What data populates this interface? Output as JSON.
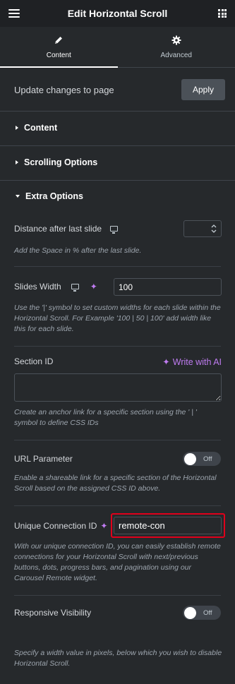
{
  "header": {
    "title": "Edit Horizontal Scroll"
  },
  "tabs": [
    {
      "label": "Content"
    },
    {
      "label": "Advanced"
    }
  ],
  "update": {
    "text": "Update changes to page",
    "apply_label": "Apply"
  },
  "sections": {
    "content": "Content",
    "scrolling": "Scrolling Options",
    "extra": "Extra Options"
  },
  "distance": {
    "label": "Distance after last slide",
    "value": "",
    "desc": "Add the Space in % after the last slide."
  },
  "slides_width": {
    "label": "Slides Width",
    "value": "100",
    "desc": "Use the '|' symbol to set custom widths for each slide within the Horizontal Scroll. For Example '100 | 50 | 100' add width like this for each slide."
  },
  "section_id": {
    "label": "Section ID",
    "ai_label": "Write with AI",
    "value": "",
    "desc": "Create an anchor link for a specific section using the ' | ' symbol to define CSS IDs"
  },
  "url_param": {
    "label": "URL Parameter",
    "toggle": "Off",
    "desc": "Enable a shareable link for a specific section of the Horizontal Scroll based on the assigned CSS ID above."
  },
  "unique_id": {
    "label": "Unique Connection ID",
    "value": "remote-con",
    "desc": "With our unique connection ID, you can easily establish remote connections for your Horizontal Scroll with next/previous buttons, dots, progress bars, and pagination using our Carousel Remote widget."
  },
  "responsive": {
    "label": "Responsive Visibility",
    "toggle": "Off",
    "desc": "Specify a width value in pixels, below which you wish to disable Horizontal Scroll."
  },
  "colors": {
    "accent_purple": "#c07cf2",
    "highlight_red": "#e0001b",
    "panel_bg": "#26292c"
  }
}
